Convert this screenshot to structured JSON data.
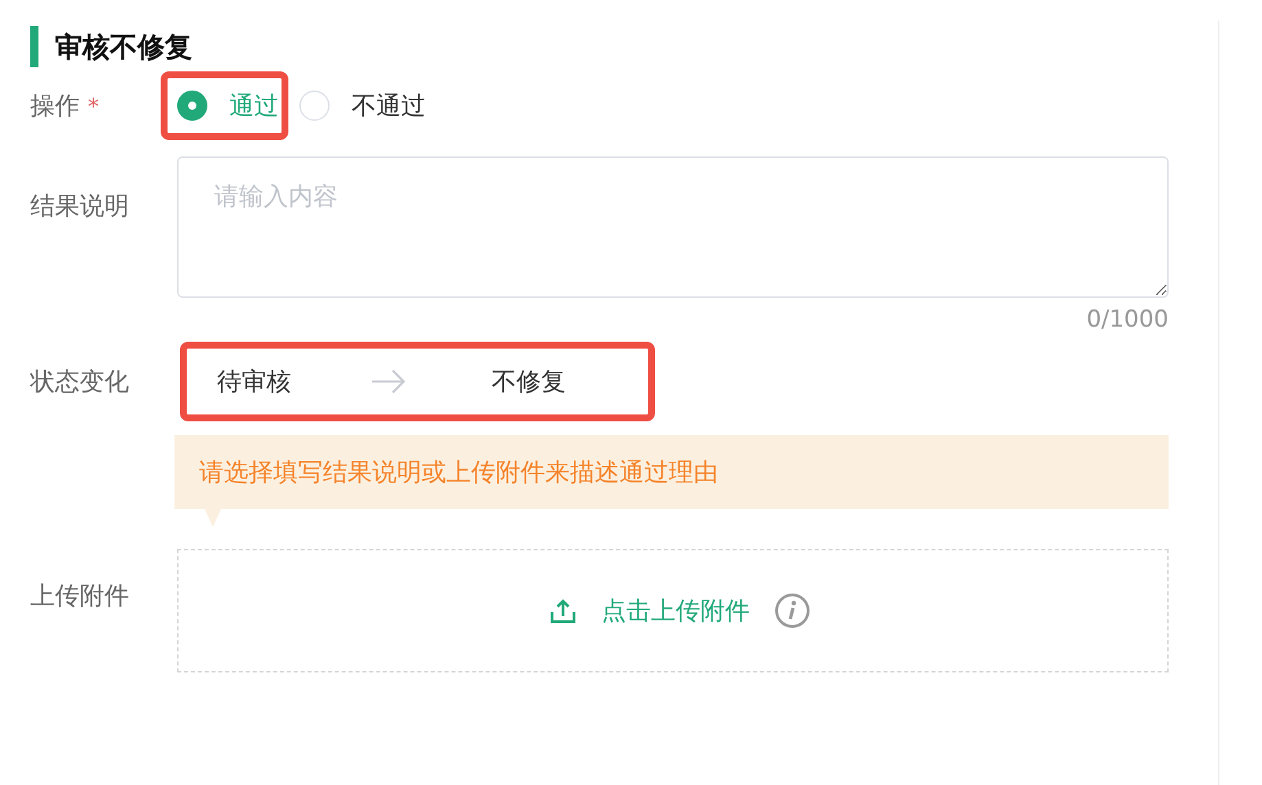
{
  "section": {
    "title": "审核不修复"
  },
  "operation": {
    "label": "操作",
    "required_mark": "*",
    "options": [
      {
        "label": "通过",
        "selected": true,
        "highlighted": true
      },
      {
        "label": "不通过",
        "selected": false,
        "highlighted": false
      }
    ]
  },
  "result": {
    "label": "结果说明",
    "placeholder": "请输入内容",
    "counter": "0/1000"
  },
  "status_change": {
    "label": "状态变化",
    "from": "待审核",
    "to": "不修复",
    "highlighted": true
  },
  "alert": {
    "text": "请选择填写结果说明或上传附件来描述通过理由"
  },
  "upload": {
    "label": "上传附件",
    "button": "点击上传附件"
  }
}
